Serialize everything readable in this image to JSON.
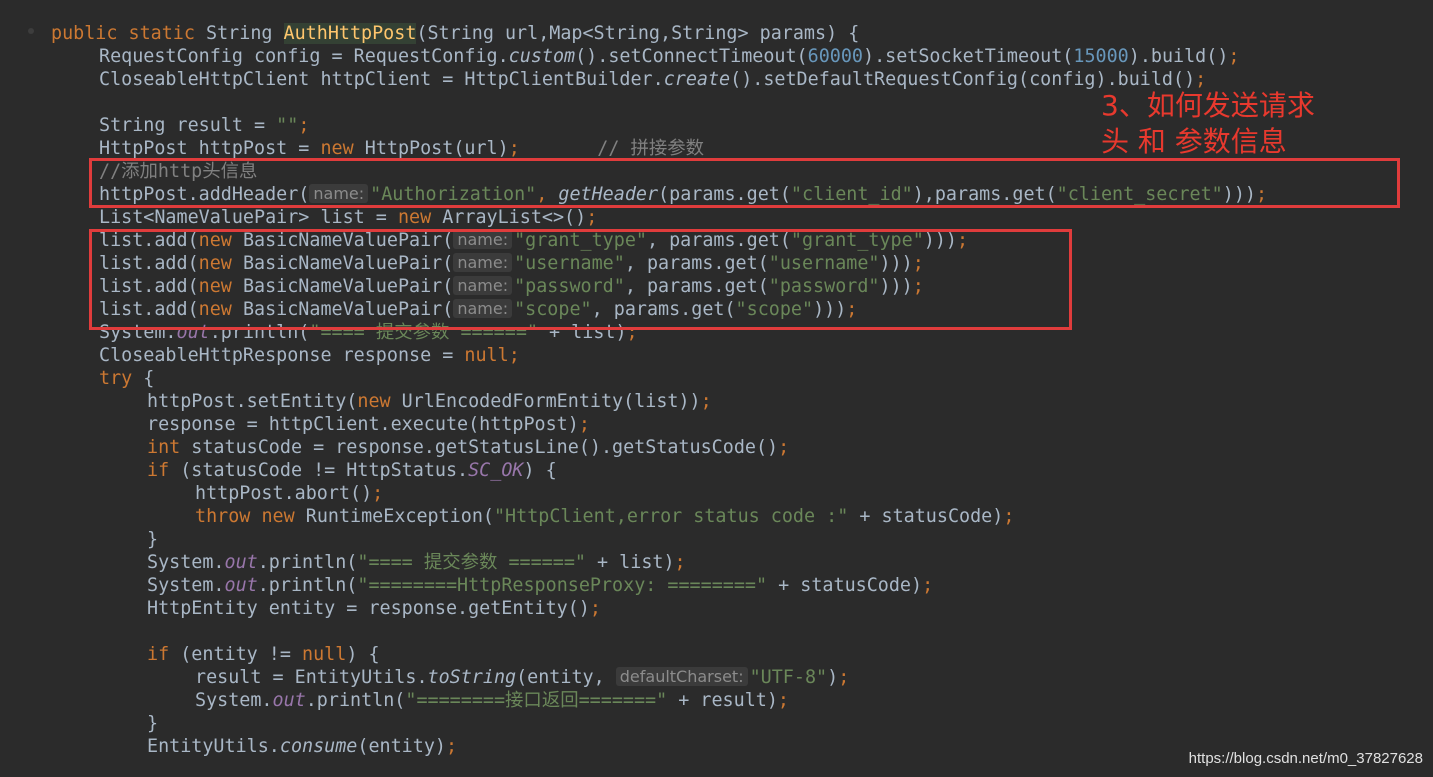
{
  "code": {
    "line1": {
      "public": "public",
      "static": "static",
      "ret": " String ",
      "method": "AuthHttpPost",
      "p1": "(String url,Map<String,String> params) {"
    },
    "line2": {
      "a": "RequestConfig config = RequestConfig.",
      "custom": "custom",
      "b": "().setConnectTimeout(",
      "n1": "60000",
      "c": ").setSocketTimeout(",
      "n2": "15000",
      "d": ").build()",
      "semi": ";"
    },
    "line3": {
      "a": "CloseableHttpClient httpClient = HttpClientBuilder.",
      "create": "create",
      "b": "().setDefaultRequestConfig(config).build()",
      "semi": ";"
    },
    "line5": {
      "a": "String result = ",
      "str": "\"\"",
      "semi": ";"
    },
    "line6": {
      "a": "HttpPost httpPost = ",
      "new": "new",
      "b": " HttpPost(url)",
      "semi": ";",
      "comment": "       // 拼接参数"
    },
    "line7": {
      "comment": "//添加http头信息"
    },
    "line8": {
      "a": "httpPost.addHeader(",
      "hint": "name:",
      "str1": "\"Authorization\"",
      "comma": ", ",
      "getHeader": "getHeader",
      "b": "(params.get(",
      "str2": "\"client_id\"",
      "c": "),params.get(",
      "str3": "\"client_secret\"",
      "d": ")))",
      "semi": ";"
    },
    "line9": {
      "a": "List<NameValuePair> list = ",
      "new": "new",
      "b": " ArrayList<>()",
      "semi": ";"
    },
    "line10": {
      "a": "list.add(",
      "new": "new",
      "b": " BasicNameValuePair(",
      "hint": "name:",
      "str1": "\"grant_type\"",
      "c": ", params.get(",
      "str2": "\"grant_type\"",
      "d": ")))",
      "semi": ";"
    },
    "line11": {
      "a": "list.add(",
      "new": "new",
      "b": " BasicNameValuePair(",
      "hint": "name:",
      "str1": "\"username\"",
      "c": ", params.get(",
      "str2": "\"username\"",
      "d": ")))",
      "semi": ";"
    },
    "line12": {
      "a": "list.add(",
      "new": "new",
      "b": " BasicNameValuePair(",
      "hint": "name:",
      "str1": "\"password\"",
      "c": ", params.get(",
      "str2": "\"password\"",
      "d": ")))",
      "semi": ";"
    },
    "line13": {
      "a": "list.add(",
      "new": "new",
      "b": " BasicNameValuePair(",
      "hint": "name:",
      "str1": "\"scope\"",
      "c": ", params.get(",
      "str2": "\"scope\"",
      "d": ")))",
      "semi": ";"
    },
    "line14": {
      "a": "System.",
      "out": "out",
      "b": ".println(",
      "str": "\"==== 提交参数 ======\"",
      "c": " + list)",
      "semi": ";"
    },
    "line15": {
      "a": "CloseableHttpResponse response = ",
      "null": "null",
      "semi": ";"
    },
    "line16": {
      "try": "try",
      "a": " {"
    },
    "line17": {
      "a": "httpPost.setEntity(",
      "new": "new",
      "b": " UrlEncodedFormEntity(list))",
      "semi": ";"
    },
    "line18": {
      "a": "response = httpClient.execute(httpPost)",
      "semi": ";"
    },
    "line19": {
      "int": "int",
      "a": " statusCode = response.getStatusLine().getStatusCode()",
      "semi": ";"
    },
    "line20": {
      "if": "if",
      "a": " (statusCode != HttpStatus.",
      "const": "SC_OK",
      "b": ") {"
    },
    "line21": {
      "a": "httpPost.abort()",
      "semi": ";"
    },
    "line22": {
      "throw": "throw",
      "new": "new",
      "a": " RuntimeException(",
      "str": "\"HttpClient,error status code :\"",
      "b": " + statusCode)",
      "semi": ";"
    },
    "line23": {
      "a": "}"
    },
    "line24": {
      "a": "System.",
      "out": "out",
      "b": ".println(",
      "str": "\"==== 提交参数 ======\"",
      "c": " + list)",
      "semi": ";"
    },
    "line25": {
      "a": "System.",
      "out": "out",
      "b": ".println(",
      "str": "\"========HttpResponseProxy: ========\"",
      "c": " + statusCode)",
      "semi": ";"
    },
    "line26": {
      "a": "HttpEntity entity = response.getEntity()",
      "semi": ";"
    },
    "line28": {
      "if": "if",
      "a": " (entity != ",
      "null": "null",
      "b": ") {"
    },
    "line29": {
      "a": "result = EntityUtils.",
      "toString": "toString",
      "b": "(entity, ",
      "hint": "defaultCharset:",
      "str": "\"UTF-8\"",
      "c": ")",
      "semi": ";"
    },
    "line30": {
      "a": "System.",
      "out": "out",
      "b": ".println(",
      "str": "\"========接口返回=======\"",
      "c": " + result)",
      "semi": ";"
    },
    "line31": {
      "a": "}"
    },
    "line32": {
      "a": "EntityUtils.",
      "consume": "consume",
      "b": "(entity)",
      "semi": ";"
    }
  },
  "annotation": {
    "line1": "3、如何发送请求",
    "line2": "头 和 参数信息"
  },
  "watermark": "https://blog.csdn.net/m0_37827628",
  "colors": {
    "background": "#2b2b2b",
    "keyword": "#cc7832",
    "string": "#6a8759",
    "number": "#6897bb",
    "comment": "#808080",
    "plain": "#a9b7c6",
    "method_highlight": "#ffc66d",
    "static_field": "#9876aa",
    "annotation_red": "#e8392e"
  }
}
